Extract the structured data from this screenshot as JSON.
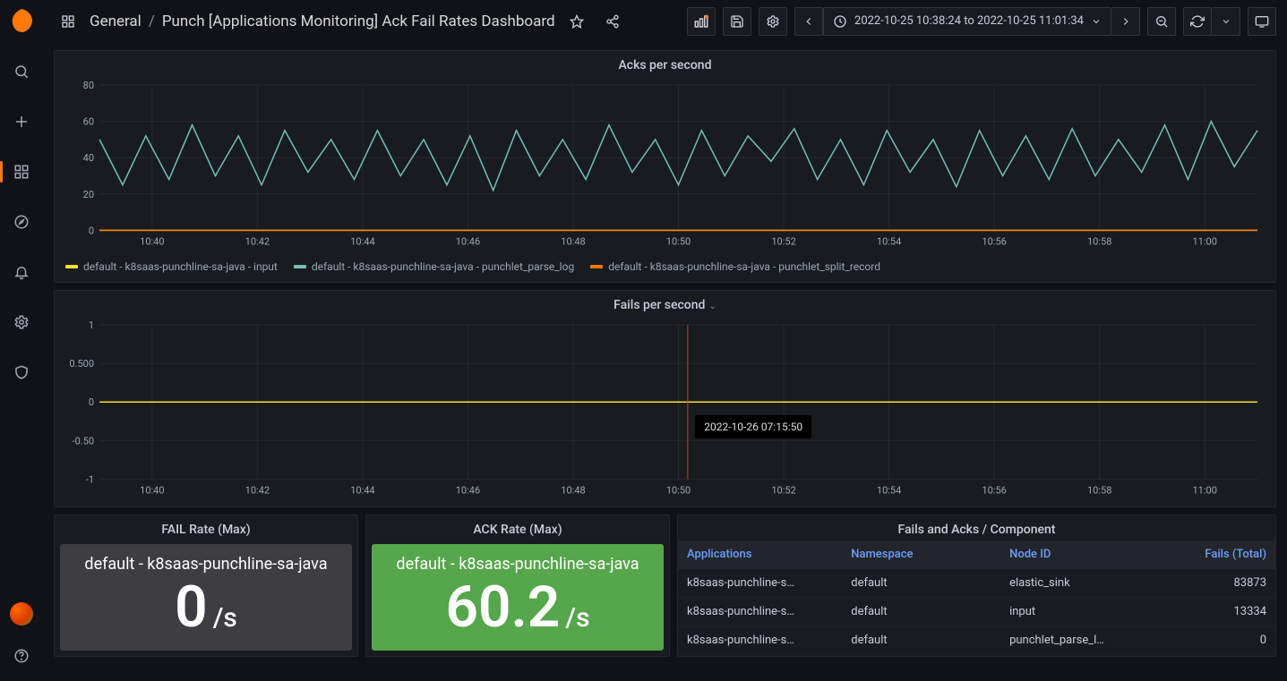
{
  "breadcrumb": {
    "folder": "General",
    "sep": "/",
    "title": "Punch [Applications Monitoring] Ack Fail Rates Dashboard"
  },
  "timepicker": {
    "label": "2022-10-25 10:38:24 to 2022-10-25 11:01:34"
  },
  "colors": {
    "series_yellow": "#fade2a",
    "series_cyan": "#73bfb8",
    "series_orange": "#ff780a",
    "accent": "#ff780a",
    "green": "#56a64b",
    "grey": "#3d3d42"
  },
  "chart_data": [
    {
      "type": "line",
      "title": "Acks per second",
      "xlabel": "",
      "ylabel": "",
      "ylim": [
        0,
        80
      ],
      "yticks": [
        0,
        20,
        40,
        60,
        80
      ],
      "xticks": [
        "10:40",
        "10:42",
        "10:44",
        "10:46",
        "10:48",
        "10:50",
        "10:52",
        "10:54",
        "10:56",
        "10:58",
        "11:00"
      ],
      "series": [
        {
          "name": "default - k8saas-punchline-sa-java - input",
          "color": "#fade2a",
          "values": [
            0,
            0,
            0,
            0,
            0,
            0,
            0,
            0,
            0,
            0,
            0,
            0,
            0,
            0,
            0,
            0,
            0,
            0,
            0,
            0,
            0,
            0,
            0,
            0,
            0,
            0,
            0,
            0,
            0,
            0,
            0,
            0,
            0,
            0,
            0,
            0,
            0,
            0,
            0,
            0,
            0,
            0,
            0,
            0,
            0,
            0,
            0,
            0,
            0,
            0
          ]
        },
        {
          "name": "default - k8saas-punchline-sa-java - punchlet_parse_log",
          "color": "#73bfb8",
          "values": [
            50,
            25,
            52,
            28,
            58,
            30,
            52,
            25,
            55,
            32,
            50,
            28,
            55,
            30,
            50,
            25,
            52,
            22,
            55,
            30,
            50,
            28,
            58,
            32,
            50,
            25,
            55,
            30,
            52,
            38,
            56,
            28,
            50,
            25,
            55,
            32,
            50,
            24,
            55,
            30,
            52,
            28,
            56,
            30,
            50,
            32,
            58,
            28,
            60,
            35,
            55
          ]
        },
        {
          "name": "default - k8saas-punchline-sa-java - punchlet_split_record",
          "color": "#ff780a",
          "values": [
            0,
            0,
            0,
            0,
            0,
            0,
            0,
            0,
            0,
            0,
            0,
            0,
            0,
            0,
            0,
            0,
            0,
            0,
            0,
            0,
            0,
            0,
            0,
            0,
            0,
            0,
            0,
            0,
            0,
            0,
            0,
            0,
            0,
            0,
            0,
            0,
            0,
            0,
            0,
            0,
            0,
            0,
            0,
            0,
            0,
            0,
            0,
            0,
            0,
            0
          ]
        }
      ]
    },
    {
      "type": "line",
      "title": "Fails per second",
      "xlabel": "",
      "ylabel": "",
      "ylim": [
        -1,
        1
      ],
      "yticks": [
        -1,
        -0.5,
        0,
        0.5,
        1
      ],
      "ytick_labels": [
        "-1",
        "-0.50",
        "0",
        "0.500",
        "1"
      ],
      "xticks": [
        "10:40",
        "10:42",
        "10:44",
        "10:46",
        "10:48",
        "10:50",
        "10:52",
        "10:54",
        "10:56",
        "10:58",
        "11:00"
      ],
      "series": [
        {
          "name": "default - k8saas-punchline-sa-java - input",
          "color": "#fade2a",
          "values": [
            0,
            0,
            0,
            0,
            0,
            0,
            0,
            0,
            0,
            0,
            0,
            0,
            0,
            0,
            0,
            0,
            0,
            0,
            0,
            0,
            0,
            0,
            0,
            0,
            0,
            0,
            0,
            0,
            0,
            0,
            0,
            0,
            0,
            0,
            0,
            0,
            0,
            0,
            0,
            0,
            0,
            0,
            0,
            0,
            0,
            0,
            0,
            0,
            0,
            0
          ]
        }
      ],
      "cursor": {
        "x_frac": 0.508,
        "tooltip": "2022-10-26 07:15:50"
      }
    }
  ],
  "stats": {
    "fail": {
      "title": "FAIL Rate (Max)",
      "label": "default - k8saas-punchline-sa-java",
      "value": "0",
      "unit": "/s"
    },
    "ack": {
      "title": "ACK Rate (Max)",
      "label": "default - k8saas-punchline-sa-java",
      "value": "60.2",
      "unit": "/s"
    }
  },
  "table": {
    "title": "Fails and Acks / Component",
    "columns": [
      "Applications",
      "Namespace",
      "Node ID",
      "Fails (Total)"
    ],
    "rows": [
      [
        "k8saas-punchline-s…",
        "default",
        "elastic_sink",
        "83873"
      ],
      [
        "k8saas-punchline-s…",
        "default",
        "input",
        "13334"
      ],
      [
        "k8saas-punchline-s…",
        "default",
        "punchlet_parse_log",
        "0"
      ]
    ]
  }
}
